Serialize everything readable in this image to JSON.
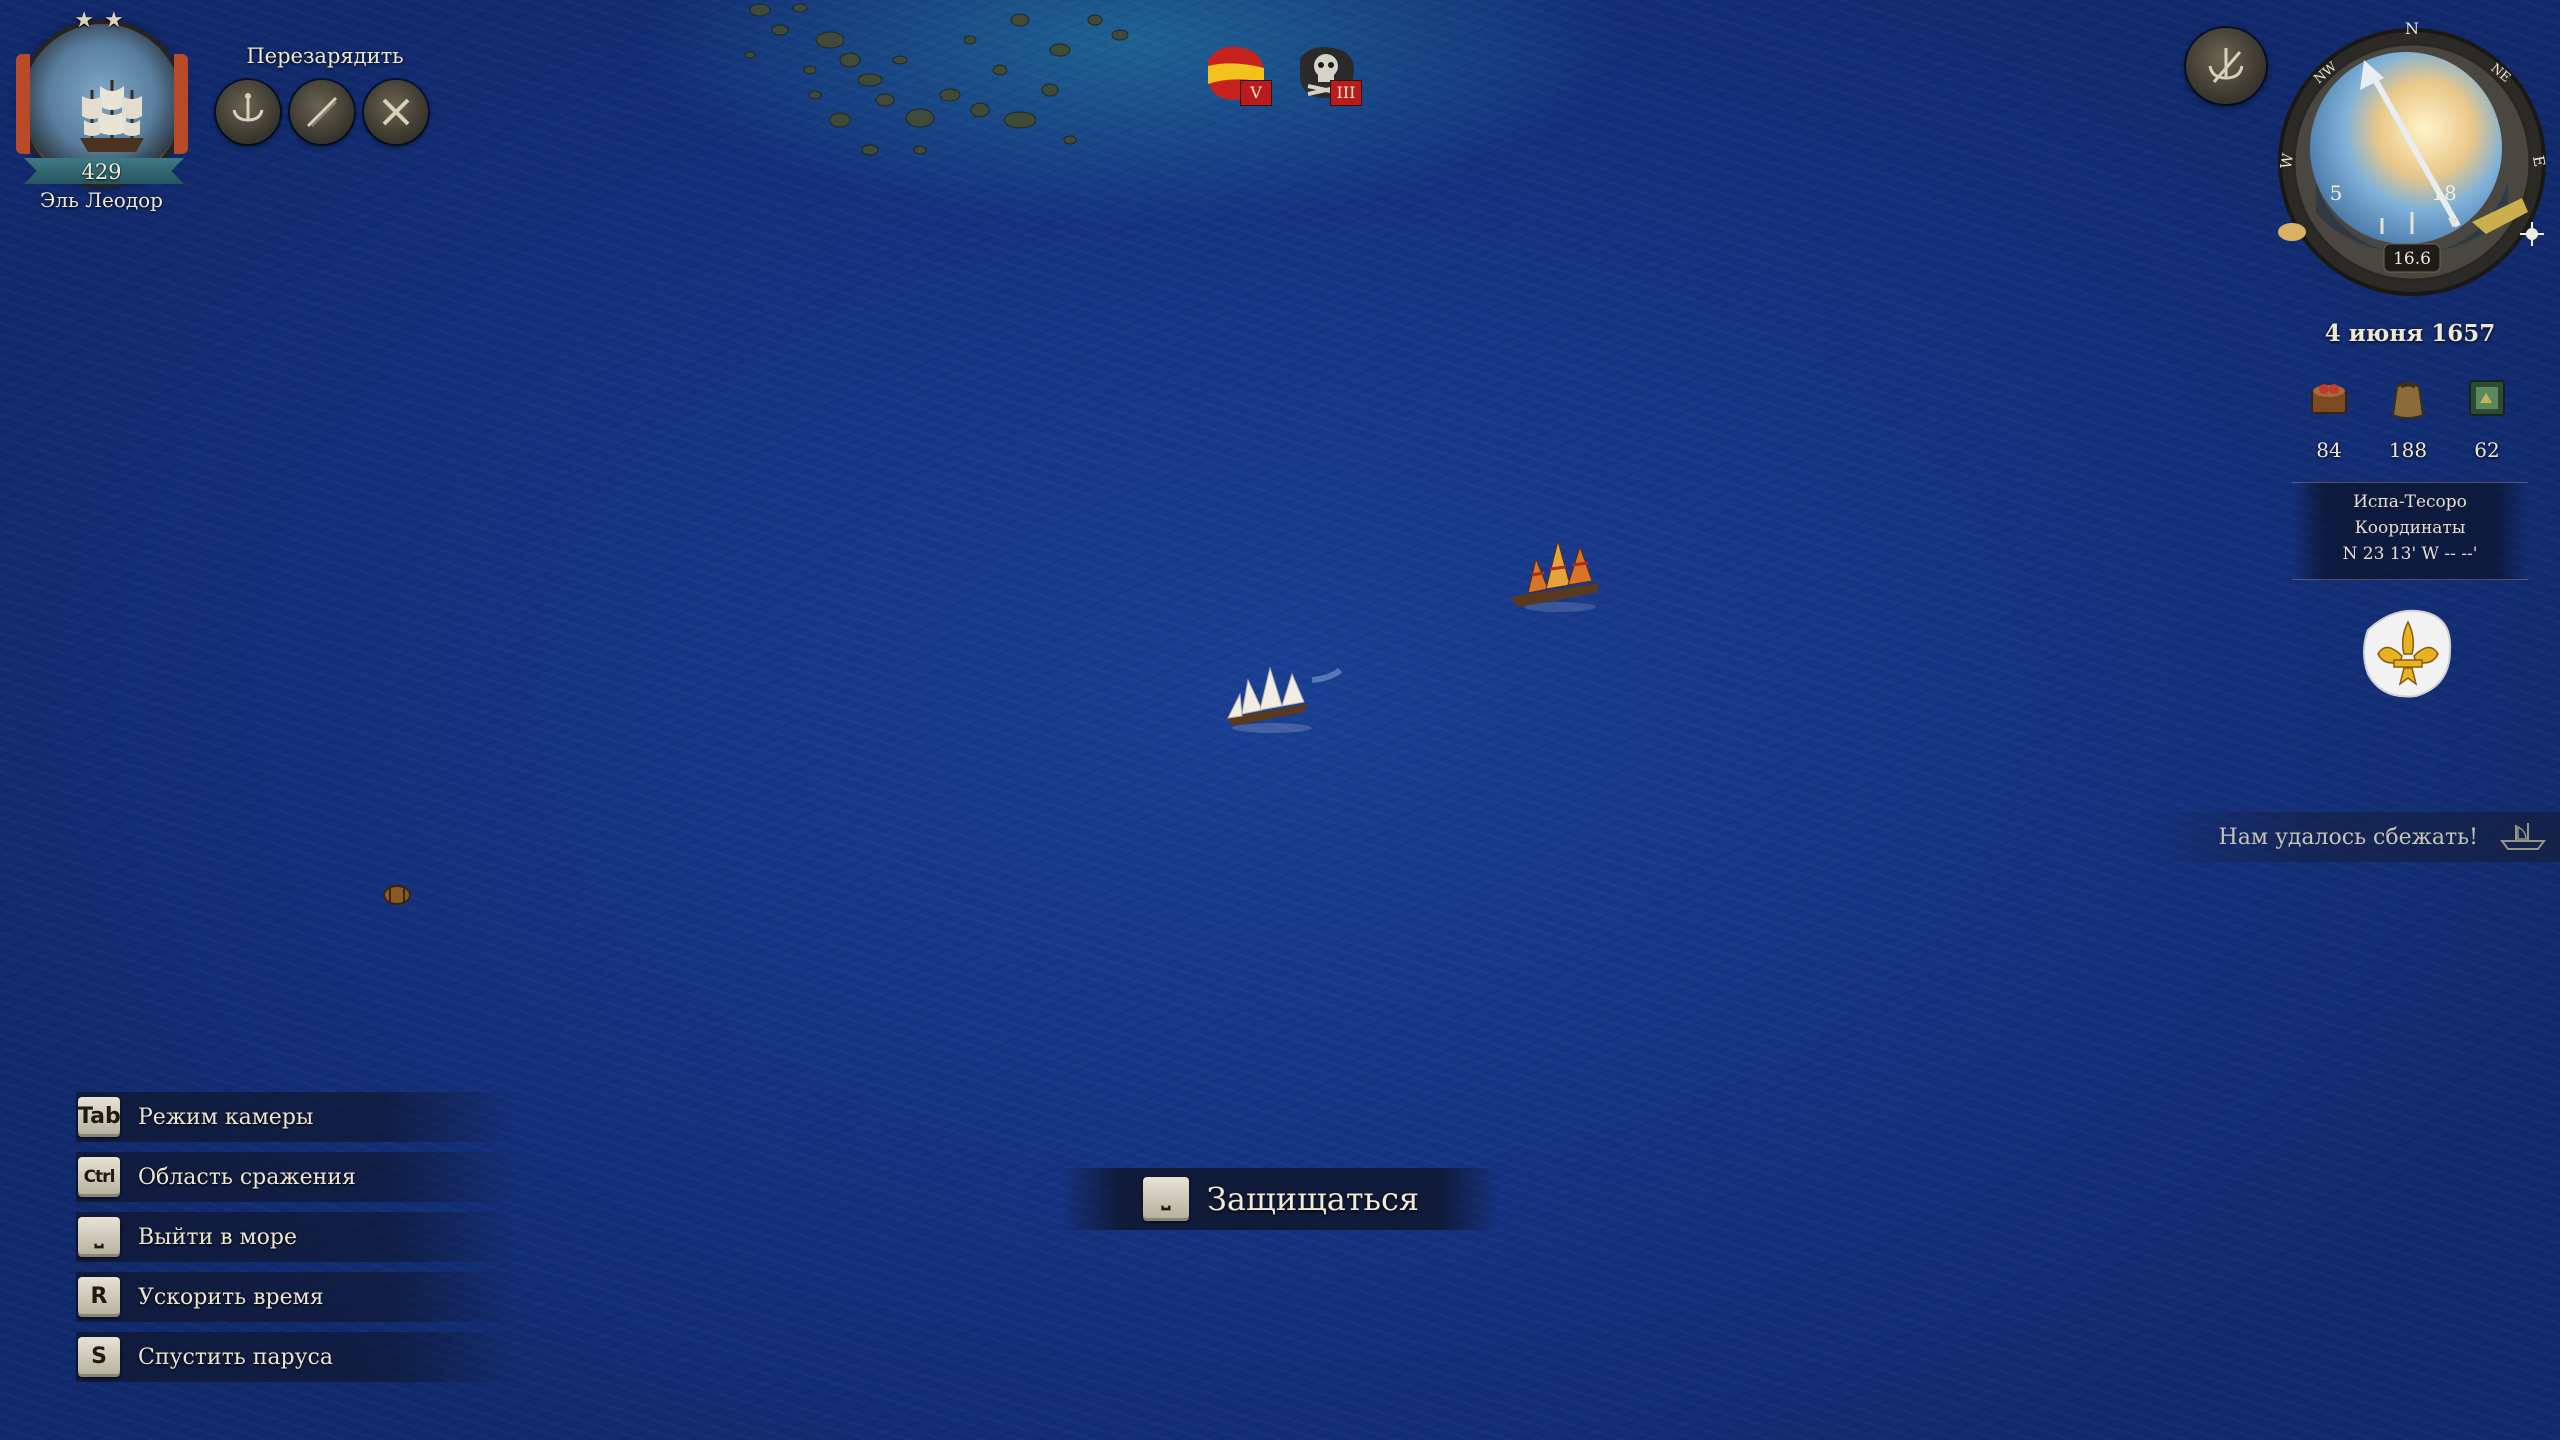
{
  "captain": {
    "level": "429",
    "name": "Эль Леодор",
    "stars": "★★"
  },
  "reload": {
    "title": "Перезарядить",
    "ammo": [
      {
        "icon": "grapeshot-icon"
      },
      {
        "icon": "chain-shot-icon"
      },
      {
        "icon": "cannonball-icon"
      }
    ]
  },
  "badges": [
    {
      "icon": "spain-flag-icon",
      "rank": "V"
    },
    {
      "icon": "pirate-skull-icon",
      "rank": "III"
    }
  ],
  "compass": {
    "north": "N",
    "nw": "NW",
    "ne": "NE",
    "west": "W",
    "east": "E",
    "wind_left": "5",
    "wind_right": "18",
    "speed": "16.6"
  },
  "date": "4 июня 1657",
  "resources": [
    {
      "icon": "food-crate-icon",
      "value": "84"
    },
    {
      "icon": "supplies-sack-icon",
      "value": "188"
    },
    {
      "icon": "map-chart-icon",
      "value": "62"
    }
  ],
  "location": {
    "name": "Испа-Тесоро",
    "coords_label": "Координаты",
    "coords_value": "N 23 13' W -- --'"
  },
  "notification": "Нам удалось сбежать!",
  "hints": [
    {
      "key": "Tab",
      "label": "Режим камеры"
    },
    {
      "key": "Ctrl",
      "label": "Область сражения"
    },
    {
      "key": "⎵",
      "label": "Выйти в море"
    },
    {
      "key": "R",
      "label": "Ускорить время"
    },
    {
      "key": "S",
      "label": "Спустить паруса"
    }
  ],
  "action": {
    "key": "⎵",
    "label": "Защищаться"
  },
  "colors": {
    "sea": "#163586",
    "panel": "#0f162d",
    "rank_red": "#b81c1c"
  }
}
